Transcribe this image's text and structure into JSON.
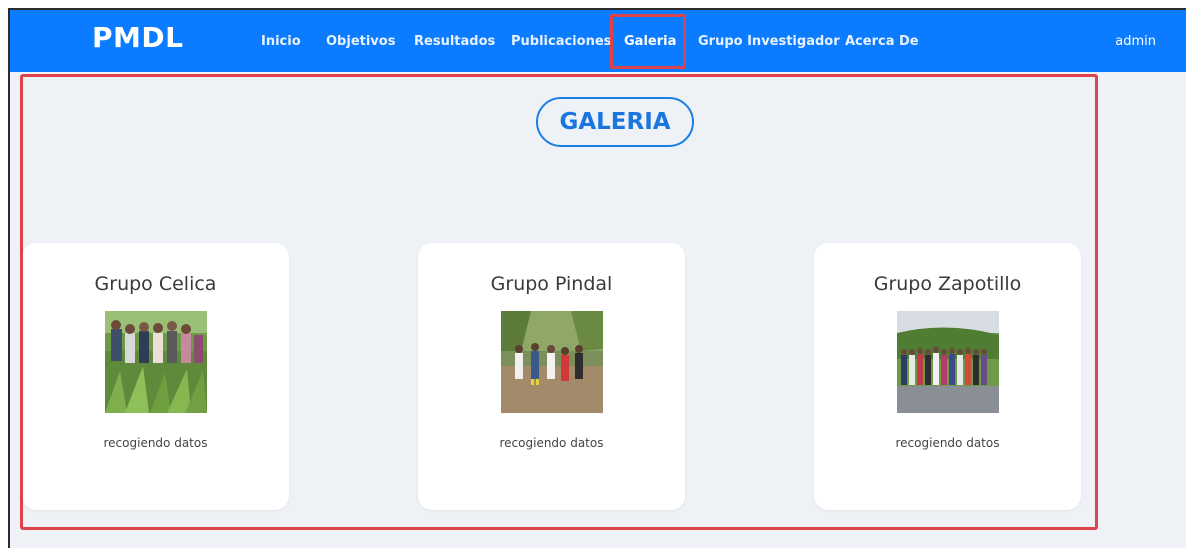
{
  "navbar": {
    "brand": "PMDL",
    "items": [
      {
        "label": "Inicio"
      },
      {
        "label": "Objetivos"
      },
      {
        "label": "Resultados"
      },
      {
        "label": "Publicaciones"
      },
      {
        "label": "Galeria"
      },
      {
        "label": "Grupo Investigador"
      },
      {
        "label": "Acerca De"
      }
    ],
    "user": "admin",
    "active_item": "Galeria"
  },
  "page": {
    "title": "GALERIA"
  },
  "gallery": {
    "cards": [
      {
        "title": "Grupo Celica",
        "caption": "recogiendo datos"
      },
      {
        "title": "Grupo Pindal",
        "caption": "recogiendo datos"
      },
      {
        "title": "Grupo Zapotillo",
        "caption": "recogiendo datos"
      }
    ]
  },
  "colors": {
    "navbar": "#0b7cff",
    "highlight": "#e0424b",
    "title": "#1a76dd",
    "background": "#eef2f7"
  }
}
